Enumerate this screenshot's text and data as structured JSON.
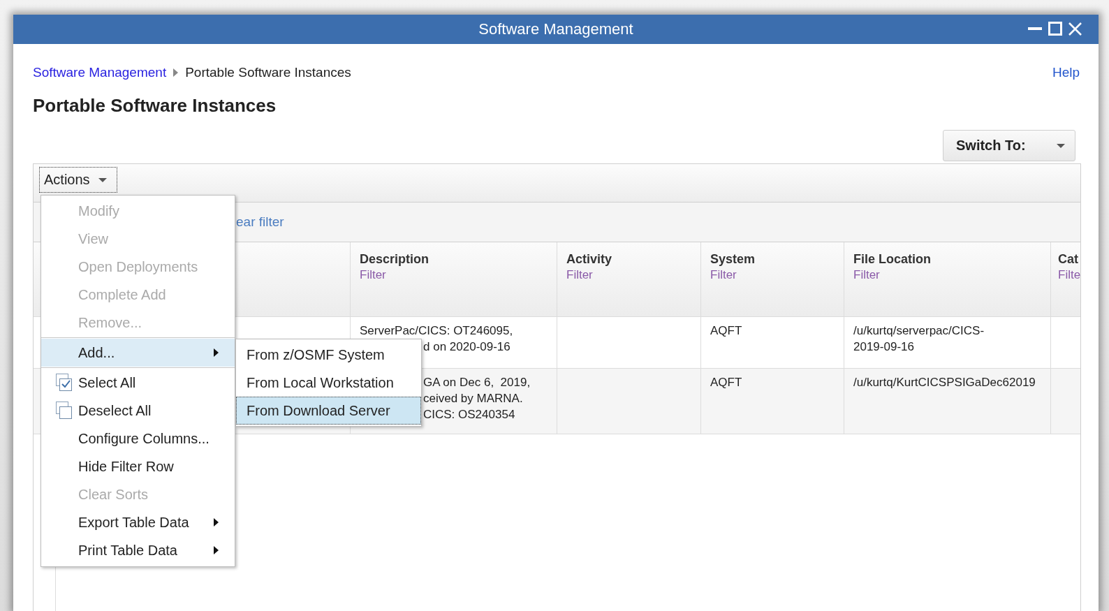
{
  "window": {
    "title": "Software Management"
  },
  "breadcrumb": [
    {
      "label": "Software Management",
      "kind": "link"
    },
    {
      "label": "Portable Software Instances",
      "kind": "current"
    }
  ],
  "help": "Help",
  "heading": "Portable Software Instances",
  "switch_to": "Switch To:",
  "actions": "Actions",
  "filter_bar": {
    "link": "ear filter"
  },
  "table": {
    "columns": [
      {
        "kind": "description",
        "label": "Description",
        "filter": "Filter"
      },
      {
        "kind": "activity",
        "label": "Activity",
        "filter": "Filter"
      },
      {
        "kind": "system",
        "label": "System",
        "filter": "Filter"
      },
      {
        "kind": "file_location",
        "label": "File Location",
        "filter": "Filter"
      },
      {
        "kind": "cat",
        "label": "Cat",
        "filter": "Filte"
      }
    ],
    "rows": [
      {
        "description": [
          {
            "text": "ServerPac/CICS: OT246095,",
            "partly_hidden": false
          },
          {
            "text": "d on 2020-09-16",
            "partly_hidden": true
          }
        ],
        "system": [
          "AQFT"
        ],
        "file_location": [
          "/u/kurtq/serverpac/CICS-",
          "2019-09-16"
        ]
      },
      {
        "description": [
          {
            "text": "GA on Dec 6,  2019,",
            "partly_hidden": true
          },
          {
            "text": "ceived by MARNA.",
            "partly_hidden": true
          },
          {
            "text": "CICS: OS240354",
            "partly_hidden": true
          }
        ],
        "system": [
          "AQFT"
        ],
        "file_location": [
          "/u/kurtq/KurtCICSPSIGaDec62019"
        ]
      }
    ]
  },
  "menu": {
    "items": [
      {
        "kind": "item",
        "label": "Modify",
        "disabled": true,
        "selected": false,
        "submenu": false
      },
      {
        "kind": "item",
        "label": "View",
        "disabled": true,
        "selected": false,
        "submenu": false
      },
      {
        "kind": "item",
        "label": "Open Deployments",
        "disabled": true,
        "selected": false,
        "submenu": false
      },
      {
        "kind": "item",
        "label": "Complete Add",
        "disabled": true,
        "selected": false,
        "submenu": false
      },
      {
        "kind": "item",
        "label": "Remove...",
        "disabled": true,
        "selected": false,
        "submenu": false
      },
      {
        "kind": "separator"
      },
      {
        "kind": "item",
        "label": "Add...",
        "disabled": false,
        "selected": true,
        "submenu": true
      },
      {
        "kind": "separator"
      },
      {
        "kind": "check",
        "label": "Select All",
        "checked": true,
        "disabled": false,
        "selected": false,
        "submenu": false
      },
      {
        "kind": "check",
        "label": "Deselect All",
        "checked": false,
        "disabled": false,
        "selected": false,
        "submenu": false
      },
      {
        "kind": "item",
        "label": "Configure Columns...",
        "disabled": false,
        "selected": false,
        "submenu": false
      },
      {
        "kind": "item",
        "label": "Hide Filter Row",
        "disabled": false,
        "selected": false,
        "submenu": false
      },
      {
        "kind": "item",
        "label": "Clear Sorts",
        "disabled": true,
        "selected": false,
        "submenu": false
      },
      {
        "kind": "item",
        "label": "Export Table Data",
        "disabled": false,
        "selected": false,
        "submenu": true
      },
      {
        "kind": "item",
        "label": "Print Table Data",
        "disabled": false,
        "selected": false,
        "submenu": true
      }
    ]
  },
  "submenu": {
    "items": [
      {
        "label": "From z/OSMF System",
        "selected": false
      },
      {
        "label": "From Local Workstation",
        "selected": false
      },
      {
        "label": "From Download Server",
        "selected": true
      }
    ]
  }
}
